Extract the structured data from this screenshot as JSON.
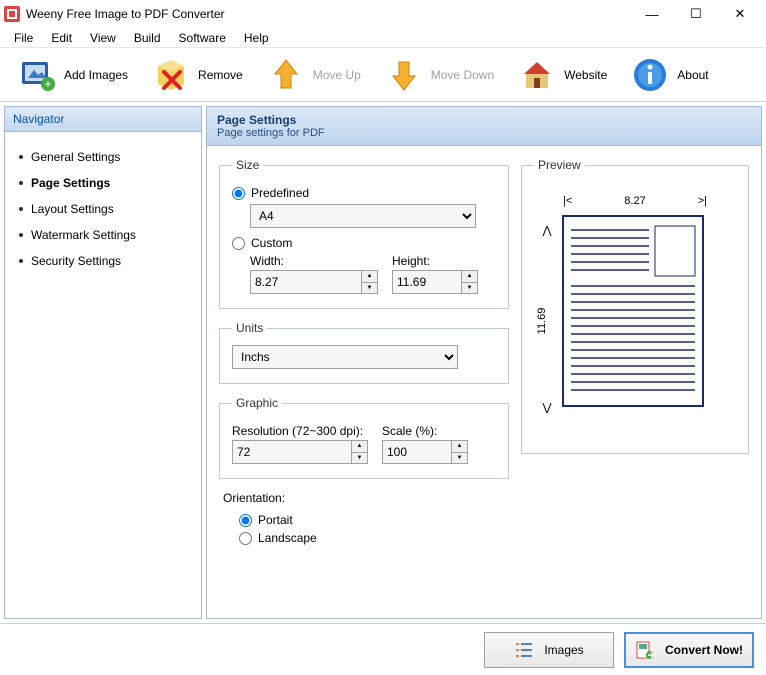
{
  "window": {
    "title": "Weeny Free Image to PDF Converter",
    "min": "—",
    "max": "☐",
    "close": "✕"
  },
  "menu": [
    "File",
    "Edit",
    "View",
    "Build",
    "Software",
    "Help"
  ],
  "toolbar": [
    {
      "id": "add-images",
      "label": "Add Images",
      "disabled": false
    },
    {
      "id": "remove",
      "label": "Remove",
      "disabled": false
    },
    {
      "id": "move-up",
      "label": "Move Up",
      "disabled": true
    },
    {
      "id": "move-down",
      "label": "Move Down",
      "disabled": true
    },
    {
      "id": "website",
      "label": "Website",
      "disabled": false
    },
    {
      "id": "about",
      "label": "About",
      "disabled": false
    }
  ],
  "navigator": {
    "header": "Navigator",
    "items": [
      "General Settings",
      "Page Settings",
      "Layout Settings",
      "Watermark Settings",
      "Security Settings"
    ],
    "active": 1
  },
  "content": {
    "title": "Page Settings",
    "subtitle": "Page settings for PDF"
  },
  "size": {
    "legend": "Size",
    "predefined_label": "Predefined",
    "predefined_selected": true,
    "preset": "A4",
    "custom_label": "Custom",
    "width_label": "Width:",
    "width": "8.27",
    "height_label": "Height:",
    "height": "11.69"
  },
  "units": {
    "legend": "Units",
    "value": "Inchs"
  },
  "graphic": {
    "legend": "Graphic",
    "resolution_label": "Resolution (72~300 dpi):",
    "resolution": "72",
    "scale_label": "Scale (%):",
    "scale": "100"
  },
  "orientation": {
    "title": "Orientation:",
    "portrait_label": "Portait",
    "landscape_label": "Landscape",
    "selected": "portrait"
  },
  "preview": {
    "legend": "Preview",
    "width_text": "8.27",
    "height_text": "11.69"
  },
  "footer": {
    "images": "Images",
    "convert": "Convert Now!"
  }
}
